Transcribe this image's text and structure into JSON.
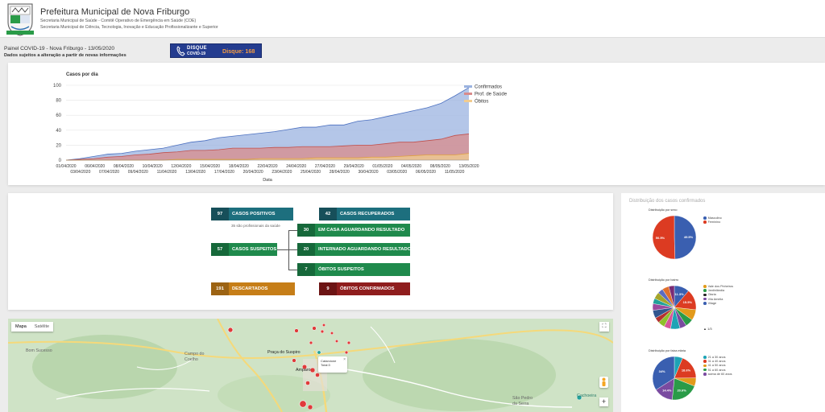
{
  "header": {
    "title": "Prefeitura Municipal de Nova Friburgo",
    "subtitle1": "Secretaria Municipal de Saúde - Comitê Operativo de Emergência em Saúde (COE)",
    "subtitle2": "Secretaria Municipal de Ciência, Tecnologia, Inovação e Educação Profissionalizante e Superior"
  },
  "panel": {
    "title": "Painel COVID-19 - Nova Friburgo - 13/05/2020",
    "note": "Dados sujeitos a alteração a partir de novas informações"
  },
  "disque": {
    "line1": "DISQUE",
    "line2": "COVID-19",
    "number": "Disque: 168",
    "brand_color": "#243c8f",
    "accent_color": "#f59c42"
  },
  "chart_data": {
    "type": "area",
    "title": "Casos por dia",
    "xlabel": "Data",
    "ylabel": "",
    "ylim": [
      0,
      100
    ],
    "yticks": [
      0,
      20,
      40,
      60,
      80,
      100
    ],
    "x_labels_top": [
      "01/04/2020",
      "06/04/2020",
      "08/04/2020",
      "10/04/2020",
      "12/04/2020",
      "15/04/2020",
      "18/04/2020",
      "22/04/2020",
      "24/04/2020",
      "27/04/2020",
      "29/04/2020",
      "01/05/2020",
      "04/05/2020",
      "08/05/2020",
      "13/05/2020"
    ],
    "x_labels_bottom": [
      "03/04/2020",
      "07/04/2020",
      "09/04/2020",
      "11/04/2020",
      "13/04/2020",
      "17/04/2020",
      "20/04/2020",
      "23/04/2020",
      "25/04/2020",
      "28/04/2020",
      "30/04/2020",
      "03/05/2020",
      "06/05/2020",
      "11/05/2020"
    ],
    "legend_position": "top-right",
    "series": [
      {
        "name": "Confirmados",
        "color": "#9bb3e0",
        "values": [
          0,
          2,
          5,
          8,
          9,
          12,
          14,
          16,
          20,
          24,
          26,
          30,
          32,
          34,
          36,
          38,
          41,
          44,
          44,
          47,
          47,
          52,
          54,
          58,
          62,
          66,
          70,
          76,
          86,
          97
        ]
      },
      {
        "name": "Prof. de Saúde",
        "color": "#d98b8b",
        "values": [
          0,
          1,
          2,
          4,
          5,
          7,
          8,
          10,
          11,
          13,
          13,
          14,
          16,
          16,
          16,
          17,
          17,
          18,
          18,
          18,
          19,
          20,
          20,
          22,
          24,
          24,
          26,
          28,
          33,
          35
        ]
      },
      {
        "name": "Óbitos",
        "color": "#f2cc8f",
        "values": [
          0,
          0,
          0,
          0,
          0,
          0,
          0,
          0,
          1,
          1,
          1,
          1,
          1,
          1,
          2,
          2,
          2,
          2,
          3,
          3,
          3,
          3,
          4,
          4,
          5,
          6,
          7,
          7,
          7,
          9
        ]
      }
    ]
  },
  "summary": {
    "positivos": {
      "num": "97",
      "label": "CASOS POSITIVOS"
    },
    "prof_note": "35 são profissionais da saúde",
    "recuperados": {
      "num": "42",
      "label": "CASOS RECUPERADOS"
    },
    "suspeitos": {
      "num": "57",
      "label": "CASOS SUSPEITOS"
    },
    "em_casa": {
      "num": "30",
      "label": "EM CASA AGUARDANDO RESULTADO"
    },
    "internado": {
      "num": "20",
      "label": "INTERNADO AGUARDANDO RESULTADO"
    },
    "obitos_suspeitos": {
      "num": "7",
      "label": "ÓBITOS SUSPEITOS"
    },
    "descartados": {
      "num": "191",
      "label": "DESCARTADOS"
    },
    "obitos_confirmados": {
      "num": "9",
      "label": "ÓBITOS CONFIRMADOS"
    }
  },
  "distribution": {
    "title": "Distribuição dos casos confirmados",
    "sexo": {
      "title": "Distribuição por sexo",
      "legend": [
        "Masculino",
        "Feminino"
      ],
      "colors": [
        "#3a5fb0",
        "#dc3b22"
      ],
      "values": [
        49.5,
        50.5
      ],
      "labels": [
        "49.5%",
        "50.5%"
      ]
    },
    "bairro": {
      "title": "Distribuição por bairro",
      "legend": [
        "Vale dos Pinheiros",
        "Jardinlândia",
        "Olaria",
        "Vila Amelia",
        "Vilage"
      ],
      "legend_colors": [
        "#e29a1b",
        "#2a9b48",
        "#222222",
        "#7a4ba0",
        "#3a5fb0"
      ],
      "page": "1/3",
      "colors": [
        "#3a5fb0",
        "#dc3b22",
        "#e29a1b",
        "#2a9b48",
        "#7a4ba0",
        "#1ea3b5",
        "#d6549a",
        "#8fbf2a",
        "#b3302e",
        "#31558f",
        "#9c4a9e",
        "#22a19a",
        "#a5a52a",
        "#5b6cc2",
        "#e0702f",
        "#7a2b74"
      ],
      "values": [
        11.3,
        15.5,
        8,
        6,
        5,
        7,
        5,
        5,
        4,
        6,
        5,
        4,
        5,
        4,
        5,
        4.2
      ],
      "labels": [
        "11.3%",
        "15.5%"
      ]
    },
    "faixa": {
      "title": "Distribuição por faixa etária",
      "legend": [
        "21 a 30 anos",
        "31 a 40 anos",
        "41 a 50 anos",
        "51 a 60 anos",
        "acima de 60 anos"
      ],
      "colors": [
        "#1ea3b5",
        "#dc3b22",
        "#e29a1b",
        "#2a9b48",
        "#7a4ba0",
        "#3a5fb0"
      ],
      "values": [
        6.2,
        18.6,
        6.2,
        20.6,
        14.4,
        34
      ],
      "labels": [
        "18.6%",
        "20.6%",
        "14.4%",
        "34%"
      ]
    }
  },
  "map": {
    "tabs": [
      "Mapa",
      "Satélite"
    ],
    "places": [
      "Bom Sucesso",
      "Campo do Coelho",
      "Praça do Suspiro",
      "São Pedro da Serra",
      "Cachoeira",
      "Amparo"
    ],
    "tooltip_l1": "Catarcione",
    "tooltip_l2": "Total:3"
  }
}
